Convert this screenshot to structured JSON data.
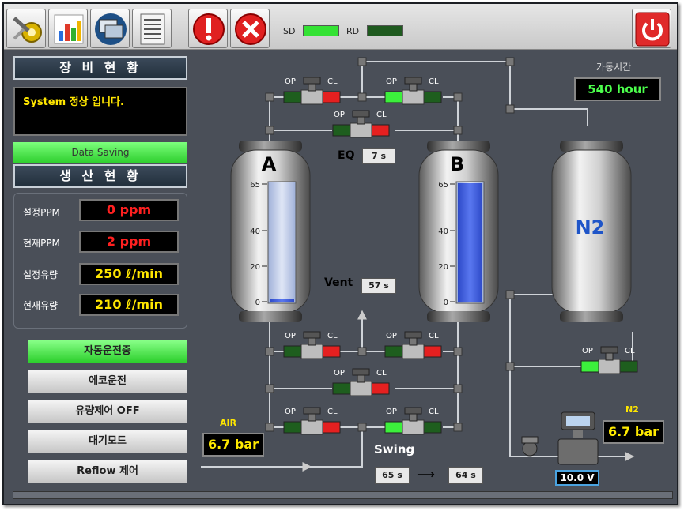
{
  "toolbar": {
    "buttons": [
      {
        "name": "setup-tools-icon"
      },
      {
        "name": "chart-icon"
      },
      {
        "name": "monitor-icon"
      },
      {
        "name": "document-icon"
      },
      {
        "name": "alarm-icon"
      },
      {
        "name": "close-icon"
      }
    ],
    "sd_label": "SD",
    "rd_label": "RD",
    "power_icon": "power-icon",
    "sd_color": "#34e234",
    "rd_color": "#1f5a1f"
  },
  "left": {
    "equipment_title": "장 비 현 황",
    "system_word": "System",
    "system_message": " 정상 입니다.",
    "data_saving": "Data Saving",
    "production_title": "생 산 현 황",
    "rows": [
      {
        "label": "설정PPM",
        "value": "0 ppm",
        "color": "#ff2020"
      },
      {
        "label": "현재PPM",
        "value": "2 ppm",
        "color": "#ff2020"
      },
      {
        "label": "설정유량",
        "value": "250 ℓ/min",
        "color": "#ffe600"
      },
      {
        "label": "현재유량",
        "value": "210 ℓ/min",
        "color": "#ffe600"
      }
    ],
    "modes": [
      {
        "label": "자동운전중",
        "active": true
      },
      {
        "label": "에코운전",
        "active": false
      },
      {
        "label": "유량제어 OFF",
        "active": false
      },
      {
        "label": "대기모드",
        "active": false
      },
      {
        "label": "Reflow 제어",
        "active": false
      }
    ]
  },
  "pid": {
    "run_time_label": "가동시간",
    "run_time_value": "540 hour",
    "tank_a": "A",
    "tank_b": "B",
    "tank_n2": "N2",
    "gauge_ticks": [
      "65",
      "40",
      "20",
      "0"
    ],
    "tank_a_level": 0.02,
    "tank_b_level": 1.0,
    "eq_label": "EQ",
    "eq_value": "7 s",
    "vent_label": "Vent",
    "vent_value": "57 s",
    "swing_label": "Swing",
    "swing_from": "65 s",
    "swing_to": "64 s",
    "air_label": "AIR",
    "air_value": "6.7 bar",
    "n2_label": "N2",
    "n2_value": "6.7 bar",
    "voltage": "10.0 V",
    "op": "OP",
    "cl": "CL"
  }
}
